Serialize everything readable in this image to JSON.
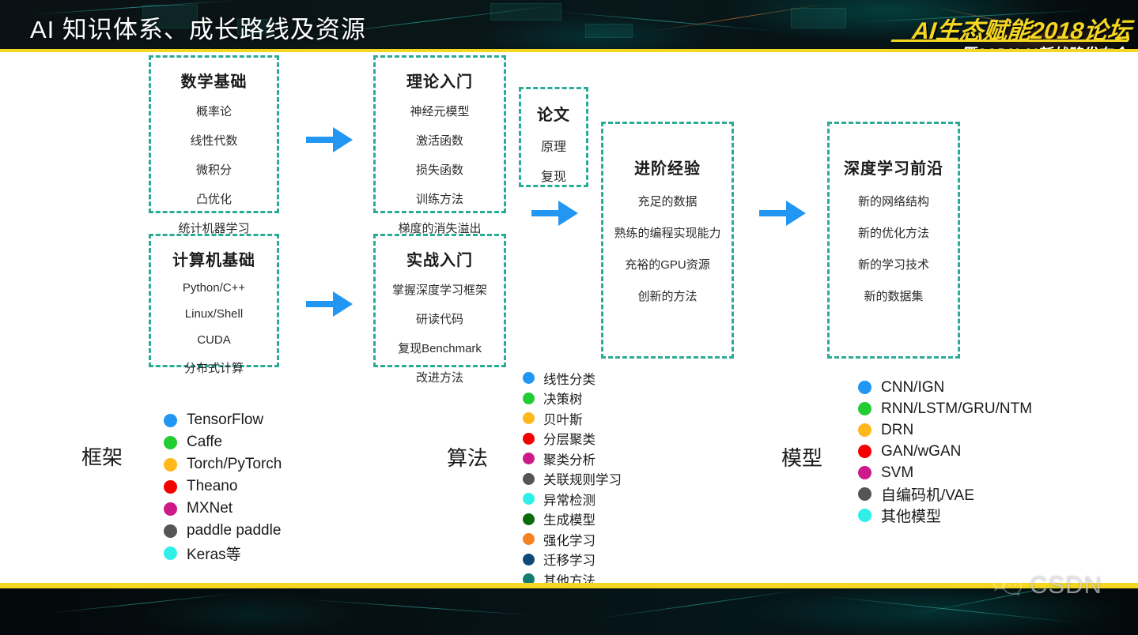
{
  "header": {
    "title": "AI 知识体系、成长路线及资源",
    "logo_main": "AI生态赋能2018论坛",
    "logo_sub": "暨CSDN AI新战略发布会",
    "accent_yellow": "#f5d722"
  },
  "theme": {
    "dashed_border": "#2aab96",
    "arrow_blue": "#2196f3",
    "text_dark": "#1a1a1a"
  },
  "boxes": [
    {
      "id": "math-foundation",
      "title": "数学基础",
      "items": [
        "概率论",
        "线性代数",
        "微积分",
        "凸优化",
        "统计机器学习"
      ]
    },
    {
      "id": "cs-foundation",
      "title": "计算机基础",
      "items": [
        "Python/C++",
        "Linux/Shell",
        "CUDA",
        "分布式计算"
      ]
    },
    {
      "id": "theory-intro",
      "title": "理论入门",
      "items": [
        "神经元模型",
        "激活函数",
        "损失函数",
        "训练方法",
        "梯度的消失溢出"
      ]
    },
    {
      "id": "practice-intro",
      "title": "实战入门",
      "items": [
        "掌握深度学习框架",
        "研读代码",
        "复现Benchmark",
        "改进方法"
      ]
    },
    {
      "id": "paper",
      "title": "论文",
      "items": [
        "原理",
        "复现"
      ]
    },
    {
      "id": "advanced-experience",
      "title": "进阶经验",
      "items": [
        "充足的数据",
        "熟练的编程实现能力",
        "充裕的GPU资源",
        "创新的方法"
      ]
    },
    {
      "id": "deep-learning-frontier",
      "title": "深度学习前沿",
      "items": [
        "新的网络结构",
        "新的优化方法",
        "新的学习技术",
        "新的数据集"
      ]
    }
  ],
  "arrows": [
    {
      "id": "arrow-math-to-theory",
      "name": "right-arrow-icon"
    },
    {
      "id": "arrow-cs-to-practice",
      "name": "right-arrow-icon"
    },
    {
      "id": "arrow-paper-to-advanced",
      "name": "right-arrow-icon"
    },
    {
      "id": "arrow-advanced-to-frontier",
      "name": "right-arrow-icon"
    }
  ],
  "legends": [
    {
      "id": "frameworks",
      "label": "框架",
      "items": [
        {
          "text": "TensorFlow",
          "color": "#2196f3"
        },
        {
          "text": "Caffe",
          "color": "#22cc33"
        },
        {
          "text": "Torch/PyTorch",
          "color": "#ffb81c"
        },
        {
          "text": "Theano",
          "color": "#f40000"
        },
        {
          "text": "MXNet",
          "color": "#cc1a8a"
        },
        {
          "text": "paddle paddle",
          "color": "#555555"
        },
        {
          "text": "Keras等",
          "color": "#2ff0e8"
        }
      ]
    },
    {
      "id": "algorithms",
      "label": "算法",
      "items": [
        {
          "text": "线性分类",
          "color": "#2196f3"
        },
        {
          "text": "决策树",
          "color": "#22cc33"
        },
        {
          "text": "贝叶斯",
          "color": "#ffb81c"
        },
        {
          "text": "分层聚类",
          "color": "#f40000"
        },
        {
          "text": "聚类分析",
          "color": "#cc1a8a"
        },
        {
          "text": "关联规则学习",
          "color": "#555555"
        },
        {
          "text": "异常检测",
          "color": "#2ff0e8"
        },
        {
          "text": "生成模型",
          "color": "#0b6b0b"
        },
        {
          "text": "强化学习",
          "color": "#f58220"
        },
        {
          "text": "迁移学习",
          "color": "#0d4a7a"
        },
        {
          "text": "其他方法",
          "color": "#137d74"
        }
      ]
    },
    {
      "id": "models",
      "label": "模型",
      "items": [
        {
          "text": "CNN/IGN",
          "color": "#2196f3"
        },
        {
          "text": "RNN/LSTM/GRU/NTM",
          "color": "#22cc33"
        },
        {
          "text": "DRN",
          "color": "#ffb81c"
        },
        {
          "text": "GAN/wGAN",
          "color": "#f40000"
        },
        {
          "text": "SVM",
          "color": "#cc1a8a"
        },
        {
          "text": "自编码机/VAE",
          "color": "#555555"
        },
        {
          "text": "其他模型",
          "color": "#2ff0e8"
        }
      ]
    }
  ],
  "footer": {
    "watermark_text": "CSDN",
    "watermark_icon": "wechat-icon"
  }
}
